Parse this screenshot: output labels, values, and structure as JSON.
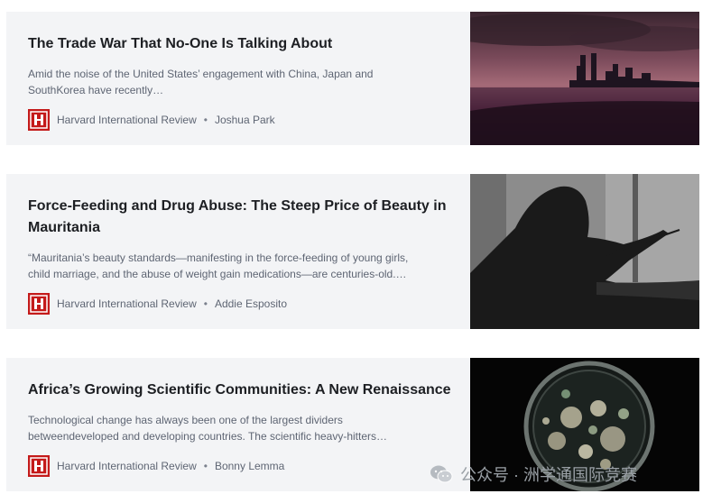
{
  "articles": [
    {
      "title": "The Trade War That No-One Is Talking About",
      "summary_line1": "Amid the noise of the United States’ engagement with China, Japan and",
      "summary_line2": "SouthKorea have recently…",
      "publication": "Harvard International Review",
      "separator": "•",
      "author": "Joshua Park",
      "image_icon": "city-skyline-dusk-image"
    },
    {
      "title_line1": "Force-Feeding and Drug Abuse: The Steep Price of Beauty in",
      "title_line2": "Mauritania",
      "summary_line1": "“Mauritania’s beauty standards—manifesting in the force-feeding of young girls,",
      "summary_line2": "child marriage, and the abuse of weight gain medications—are centuries-old.…",
      "publication": "Harvard International Review",
      "separator": "•",
      "author": "Addie Esposito",
      "image_icon": "silhouette-eating-image"
    },
    {
      "title": "Africa’s Growing Scientific Communities: A New Renaissance",
      "summary_line1": "Technological change has always been one of the largest dividers",
      "summary_line2": "betweendeveloped and developing countries. The scientific heavy-hitters…",
      "publication": "Harvard International Review",
      "separator": "•",
      "author": "Bonny Lemma",
      "image_icon": "petri-dish-image"
    }
  ],
  "publication_logo_icon": "harvard-h-logo-icon",
  "watermark": {
    "text": "公众号 · 洲学通国际竞赛",
    "icon": "wechat-icon"
  }
}
